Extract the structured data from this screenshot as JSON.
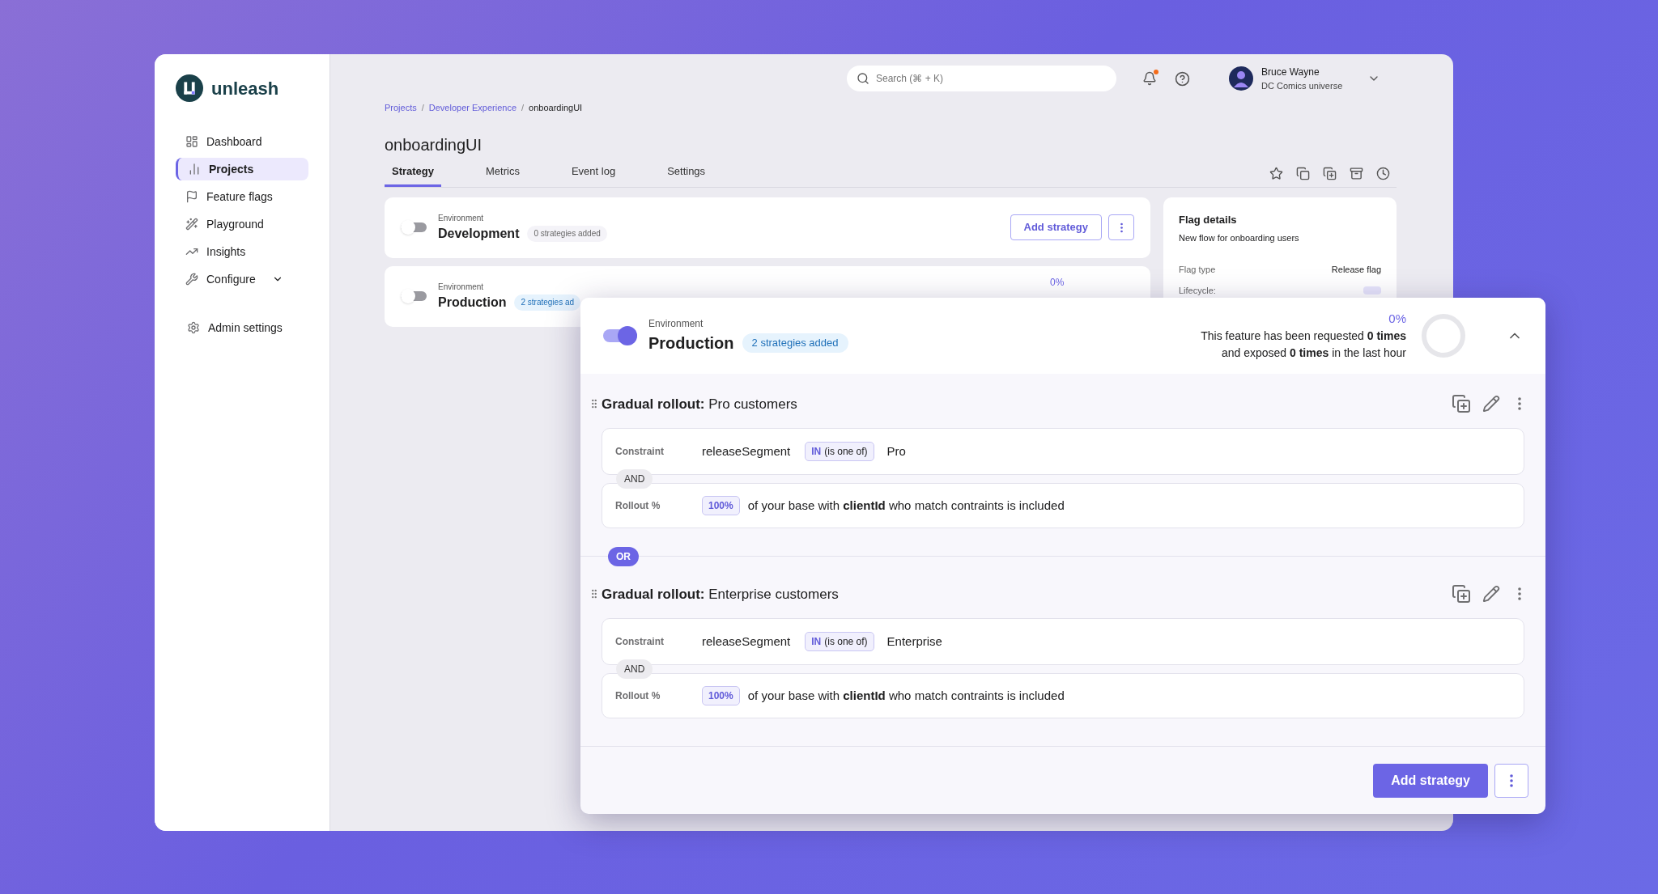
{
  "brand": {
    "name": "unleash"
  },
  "sidebar": {
    "items": [
      {
        "label": "Dashboard",
        "selected": false
      },
      {
        "label": "Projects",
        "selected": true
      },
      {
        "label": "Feature flags",
        "selected": false
      },
      {
        "label": "Playground",
        "selected": false
      },
      {
        "label": "Insights",
        "selected": false
      },
      {
        "label": "Configure",
        "selected": false,
        "expanded": false
      }
    ],
    "admin": {
      "label": "Admin settings"
    }
  },
  "header": {
    "search": {
      "placeholder": "Search (⌘ + K)"
    },
    "notifications_unread": true,
    "user": {
      "name": "Bruce Wayne",
      "org": "DC Comics universe"
    }
  },
  "breadcrumb": {
    "items": [
      "Projects",
      "Developer Experience",
      "onboardingUI"
    ],
    "separators": [
      "/",
      "/"
    ]
  },
  "title": "onboardingUI",
  "tabs": [
    {
      "label": "Strategy",
      "selected": true
    },
    {
      "label": "Metrics",
      "selected": false
    },
    {
      "label": "Event log",
      "selected": false
    },
    {
      "label": "Settings",
      "selected": false
    }
  ],
  "environments": [
    {
      "label": "Environment",
      "name": "Development",
      "enabled": false,
      "badge": "0 strategies added",
      "add_button": "Add strategy"
    },
    {
      "label": "Environment",
      "name": "Production",
      "enabled": false,
      "badge": "2 strategies ad",
      "rate": "0%"
    }
  ],
  "flag_details": {
    "title": "Flag details",
    "description": "New flow for onboarding users",
    "rows": [
      {
        "label": "Flag type",
        "value": "Release flag"
      },
      {
        "label": "Lifecycle:"
      }
    ]
  },
  "popup": {
    "label": "Environment",
    "name": "Production",
    "enabled": true,
    "badge": "2 strategies added",
    "rate": "0%",
    "stats": [
      "This feature has been requested **0 times**",
      "and exposed **0 times** in the last hour"
    ],
    "expanded": true,
    "strategies": [
      {
        "type": "Gradual rollout:",
        "title": "Pro customers",
        "constraint": {
          "label": "Constraint",
          "context": "releaseSegment",
          "operator": "IN",
          "operator_desc": "(is one of)",
          "value": "Pro"
        },
        "joiner": "AND",
        "rollout": {
          "label": "Rollout %",
          "value": "100%",
          "text": "of your base with **clientId** who match contraints is included"
        }
      },
      {
        "type": "Gradual rollout:",
        "title": "Enterprise customers",
        "constraint": {
          "label": "Constraint",
          "context": "releaseSegment",
          "operator": "IN",
          "operator_desc": "(is one of)",
          "value": "Enterprise"
        },
        "joiner": "AND",
        "rollout": {
          "label": "Rollout %",
          "value": "100%",
          "text": "of your base with **clientId** who match contraints is included"
        }
      }
    ],
    "or_label": "OR",
    "add_button": "Add strategy"
  }
}
